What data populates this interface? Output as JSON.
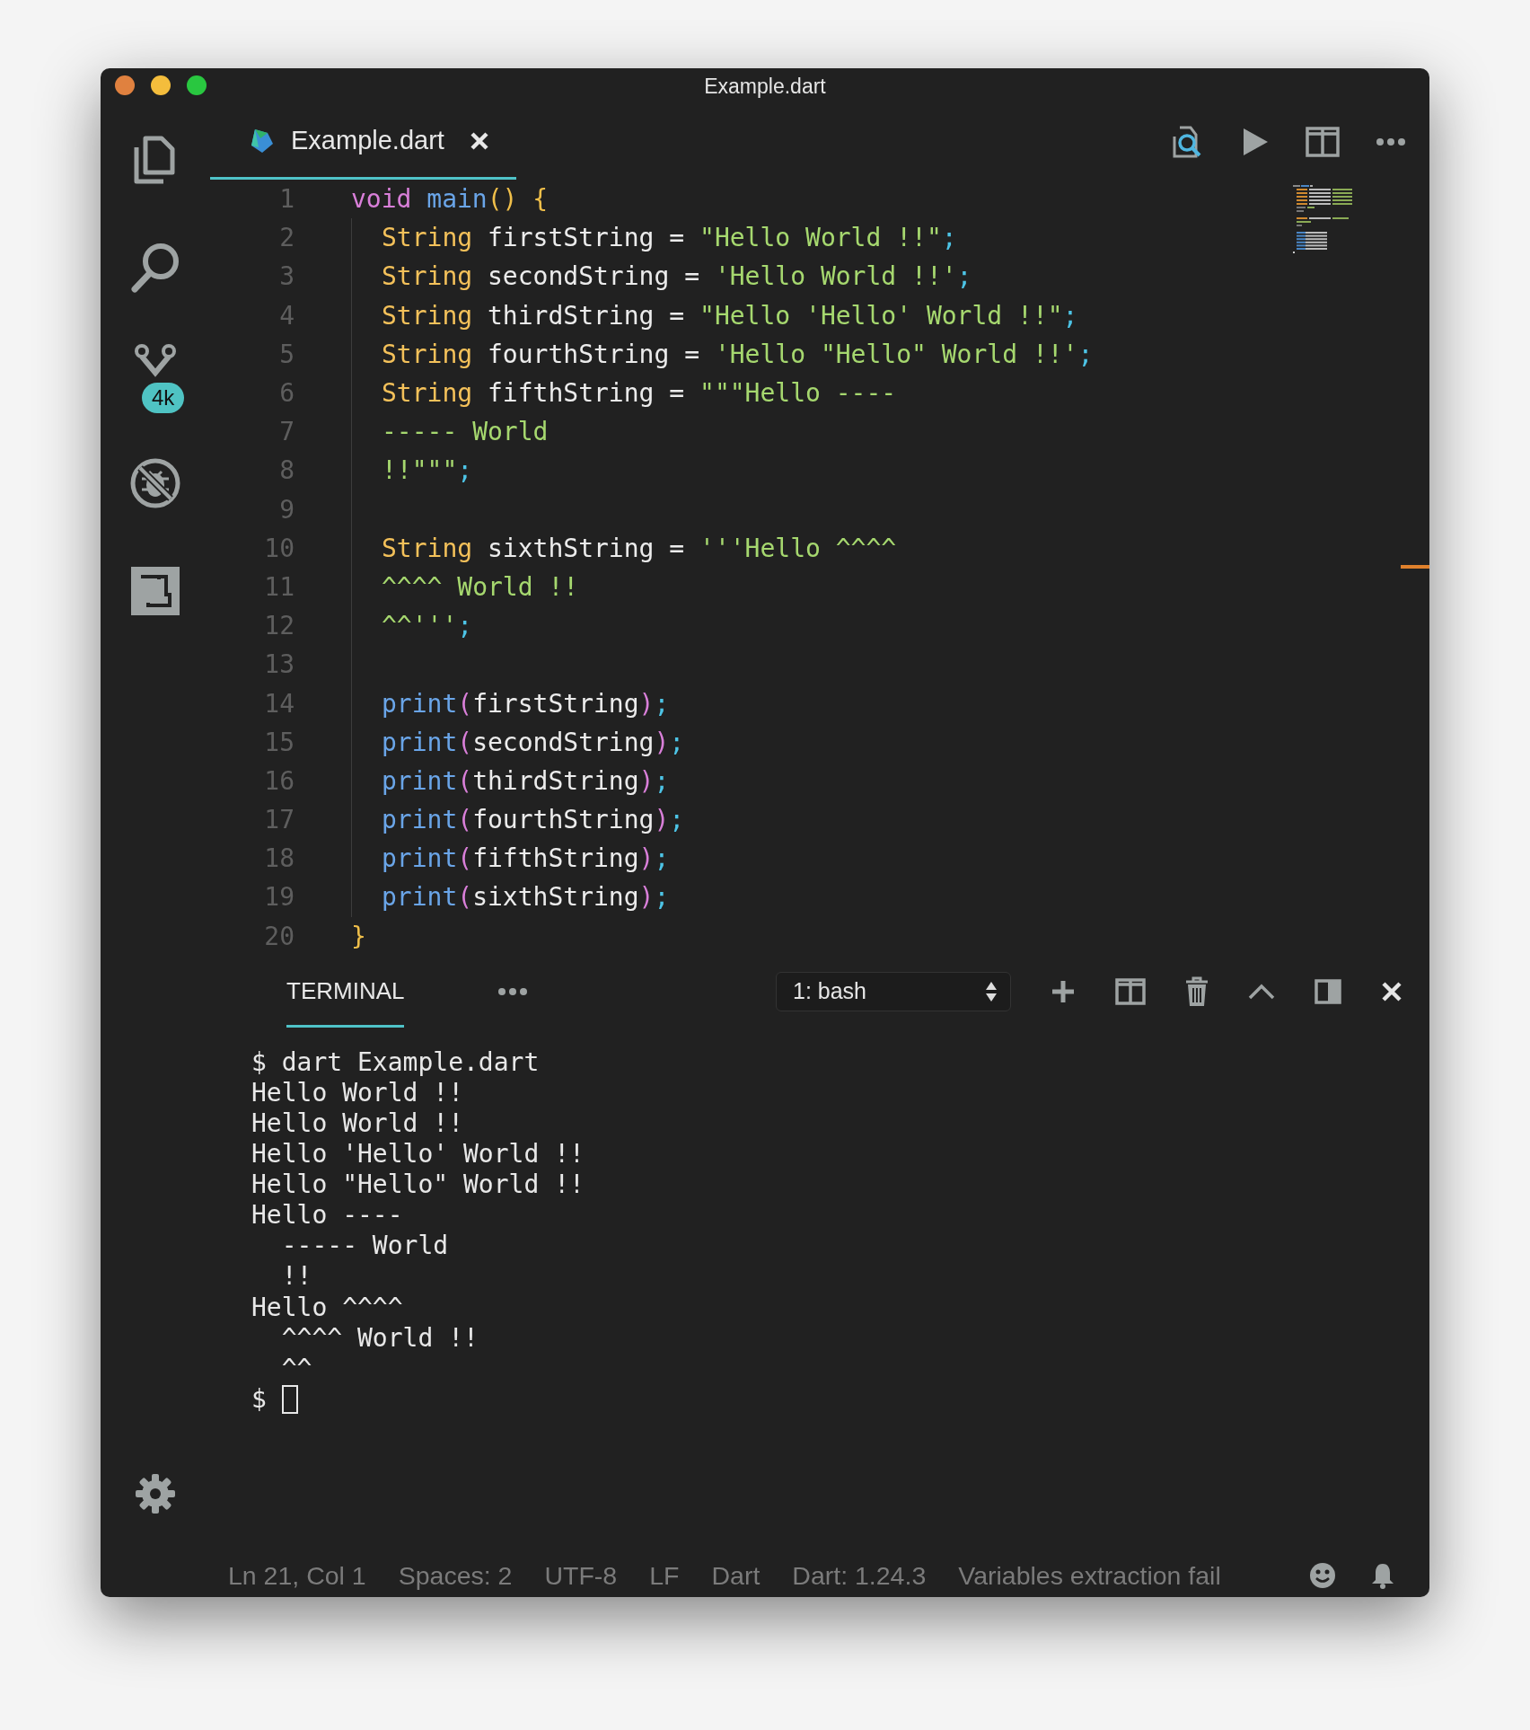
{
  "window": {
    "title": "Example.dart"
  },
  "activity_bar": {
    "items": [
      {
        "kind": "files"
      },
      {
        "kind": "search"
      },
      {
        "kind": "source-control",
        "badge": "4k"
      },
      {
        "kind": "debug"
      },
      {
        "kind": "extensions"
      }
    ],
    "bottom": [
      {
        "kind": "settings"
      }
    ]
  },
  "tabs": [
    {
      "label": "Example.dart",
      "selected": true,
      "closable": true
    }
  ],
  "editor": {
    "lines": [
      {
        "number": "1",
        "tokens": [
          {
            "kind": "keyword",
            "text": "void"
          },
          {
            "kind": "func",
            "text": " main"
          },
          {
            "kind": "brace",
            "text": "() {"
          }
        ],
        "children": [
          {
            "number": "2",
            "tokens": [
              {
                "kind": "type",
                "text": "String"
              },
              {
                "kind": "ident",
                "text": " firstString = "
              },
              {
                "kind": "string",
                "text": "\"Hello World !!\""
              },
              {
                "kind": "semi",
                "text": ";"
              }
            ]
          },
          {
            "number": "3",
            "tokens": [
              {
                "kind": "type",
                "text": "String"
              },
              {
                "kind": "ident",
                "text": " secondString = "
              },
              {
                "kind": "string",
                "text": "'Hello World !!'"
              },
              {
                "kind": "semi",
                "text": ";"
              }
            ]
          },
          {
            "number": "4",
            "tokens": [
              {
                "kind": "type",
                "text": "String"
              },
              {
                "kind": "ident",
                "text": " thirdString = "
              },
              {
                "kind": "string",
                "text": "\"Hello 'Hello' World !!\""
              },
              {
                "kind": "semi",
                "text": ";"
              }
            ]
          },
          {
            "number": "5",
            "tokens": [
              {
                "kind": "type",
                "text": "String"
              },
              {
                "kind": "ident",
                "text": " fourthString = "
              },
              {
                "kind": "string",
                "text": "'Hello \"Hello\" World !!'"
              },
              {
                "kind": "semi",
                "text": ";"
              }
            ]
          },
          {
            "number": "6",
            "tokens": [
              {
                "kind": "type",
                "text": "String"
              },
              {
                "kind": "ident",
                "text": " fifthString = "
              },
              {
                "kind": "string",
                "text": "\"\"\"Hello ----"
              }
            ]
          },
          {
            "number": "7",
            "tokens": [
              {
                "kind": "string",
                "text": "----- World"
              }
            ]
          },
          {
            "number": "8",
            "tokens": [
              {
                "kind": "string",
                "text": "!!\"\"\""
              },
              {
                "kind": "semi",
                "text": ";"
              }
            ]
          },
          {
            "number": "9"
          },
          {
            "number": "10",
            "tokens": [
              {
                "kind": "type",
                "text": "String"
              },
              {
                "kind": "ident",
                "text": " sixthString = "
              },
              {
                "kind": "string",
                "text": "'''Hello ^^^^"
              }
            ]
          },
          {
            "number": "11",
            "tokens": [
              {
                "kind": "string",
                "text": "^^^^ World !!"
              }
            ]
          },
          {
            "number": "12",
            "tokens": [
              {
                "kind": "string",
                "text": "^^'''"
              },
              {
                "kind": "semi",
                "text": ";"
              }
            ]
          },
          {
            "number": "13"
          },
          {
            "number": "14",
            "tokens": [
              {
                "kind": "func",
                "text": "print"
              },
              {
                "kind": "paren",
                "text": "("
              },
              {
                "kind": "ident",
                "text": "firstString"
              },
              {
                "kind": "paren",
                "text": ")"
              },
              {
                "kind": "semi",
                "text": ";"
              }
            ]
          },
          {
            "number": "15",
            "tokens": [
              {
                "kind": "func",
                "text": "print"
              },
              {
                "kind": "paren",
                "text": "("
              },
              {
                "kind": "ident",
                "text": "secondString"
              },
              {
                "kind": "paren",
                "text": ")"
              },
              {
                "kind": "semi",
                "text": ";"
              }
            ]
          },
          {
            "number": "16",
            "tokens": [
              {
                "kind": "func",
                "text": "print"
              },
              {
                "kind": "paren",
                "text": "("
              },
              {
                "kind": "ident",
                "text": "thirdString"
              },
              {
                "kind": "paren",
                "text": ")"
              },
              {
                "kind": "semi",
                "text": ";"
              }
            ]
          },
          {
            "number": "17",
            "tokens": [
              {
                "kind": "func",
                "text": "print"
              },
              {
                "kind": "paren",
                "text": "("
              },
              {
                "kind": "ident",
                "text": "fourthString"
              },
              {
                "kind": "paren",
                "text": ")"
              },
              {
                "kind": "semi",
                "text": ";"
              }
            ]
          },
          {
            "number": "18",
            "tokens": [
              {
                "kind": "func",
                "text": "print"
              },
              {
                "kind": "paren",
                "text": "("
              },
              {
                "kind": "ident",
                "text": "fifthString"
              },
              {
                "kind": "paren",
                "text": ")"
              },
              {
                "kind": "semi",
                "text": ";"
              }
            ]
          },
          {
            "number": "19",
            "tokens": [
              {
                "kind": "func",
                "text": "print"
              },
              {
                "kind": "paren",
                "text": "("
              },
              {
                "kind": "ident",
                "text": "sixthString"
              },
              {
                "kind": "paren",
                "text": ")"
              },
              {
                "kind": "semi",
                "text": ";"
              }
            ]
          }
        ]
      },
      {
        "number": "20",
        "tokens": [
          {
            "kind": "brace",
            "text": "}"
          }
        ]
      }
    ]
  },
  "terminal": {
    "tab": {
      "label": "TERMINAL",
      "selected": true
    },
    "shell": "1: bash",
    "lines": [
      "$ dart Example.dart",
      "Hello World !!",
      "Hello World !!",
      "Hello 'Hello' World !!",
      "Hello \"Hello\" World !!",
      "Hello ----",
      "  ----- World",
      "  !!",
      "Hello ^^^^",
      "  ^^^^ World !!",
      "  ^^",
      "$"
    ],
    "cursor": true
  },
  "status_bar": {
    "items": [
      "Ln 21, Col 1",
      "Spaces: 2",
      "UTF-8",
      "LF",
      "Dart",
      "Dart: 1.24.3",
      "Variables extraction fail"
    ]
  }
}
